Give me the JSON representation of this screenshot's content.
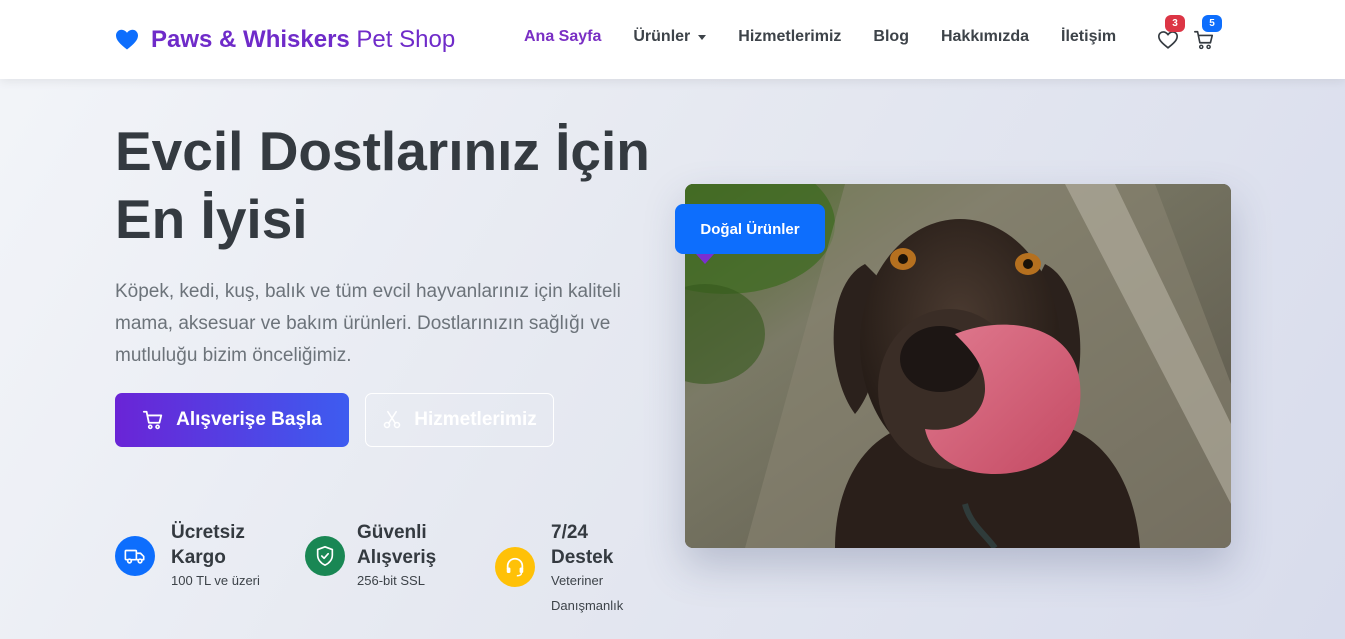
{
  "brand": {
    "name_bold": "Paws & Whiskers",
    "name_thin": "Pet Shop"
  },
  "nav": {
    "items": [
      {
        "label": "Ana Sayfa",
        "active": true
      },
      {
        "label": "Ürünler",
        "dropdown": true
      },
      {
        "label": "Hizmetlerimiz"
      },
      {
        "label": "Blog"
      },
      {
        "label": "Hakkımızda"
      },
      {
        "label": "İletişim"
      }
    ],
    "wishlist_count": "3",
    "cart_count": "5"
  },
  "hero": {
    "title_line1": "Evcil Dostlarınız İçin",
    "title_line2": "En İyisi",
    "description": "Köpek, kedi, kuş, balık ve tüm evcil hayvanlarınız için kaliteli mama, aksesuar ve bakım ürünleri. Dostlarınızın sağlığı ve mutluluğu bizim önceliğimiz.",
    "primary_button": "Alışverişe Başla",
    "secondary_button": "Hizmetlerimiz",
    "image_tag": "Doğal Ürünler"
  },
  "features": [
    {
      "title_line1": "Ücretsiz",
      "title_line2": "Kargo",
      "subtitle": "100 TL ve üzeri",
      "icon": "truck-icon",
      "color": "#0d6efd"
    },
    {
      "title_line1": "Güvenli",
      "title_line2": "Alışveriş",
      "subtitle": "256-bit SSL",
      "icon": "shield-check-icon",
      "color": "#198754"
    },
    {
      "title_line1": "7/24",
      "title_line2": "Destek",
      "subtitle_line1": "Veteriner",
      "subtitle_line2": "Danışmanlık",
      "icon": "headset-icon",
      "color": "#ffc107"
    }
  ],
  "colors": {
    "brand": "#6f2bc9",
    "accent_blue": "#0d6efd",
    "primary_gradient_start": "#6a24d6",
    "primary_gradient_end": "#3d5cf0"
  }
}
